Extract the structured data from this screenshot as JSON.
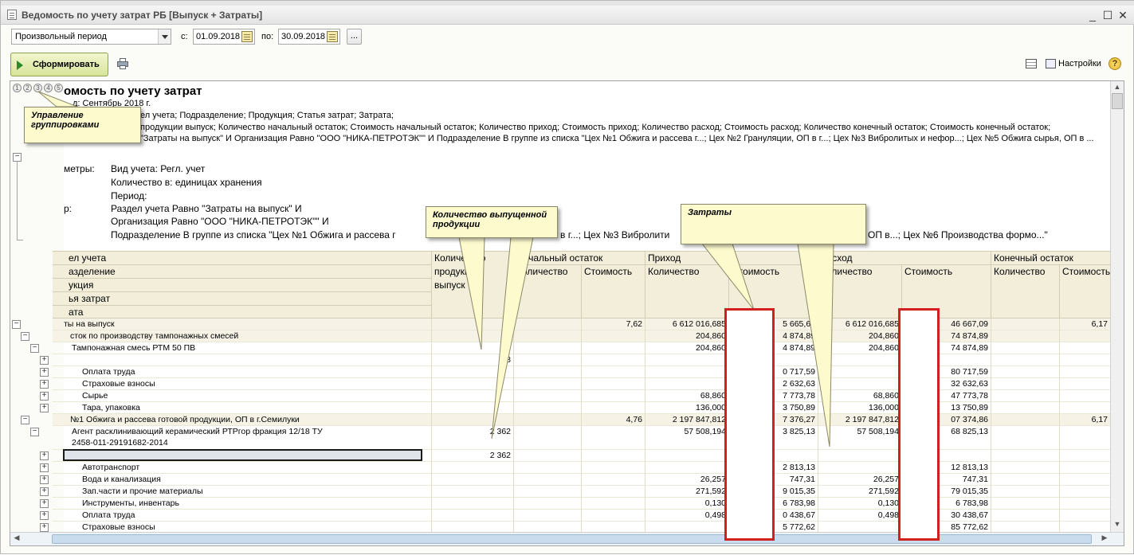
{
  "window": {
    "title": "Ведомость по учету затрат РБ [Выпуск + Затраты]",
    "controls": [
      "_",
      "☐",
      "✕"
    ]
  },
  "period": {
    "select_value": "Произвольный период",
    "from_label": "с:",
    "from_value": "01.09.2018",
    "to_label": "по:",
    "to_value": "30.09.2018",
    "more_label": "..."
  },
  "toolbar": {
    "generate_label": "Сформировать",
    "settings_label": "Настройки",
    "help_label": "?"
  },
  "group_levels": [
    "1",
    "2",
    "3",
    "4",
    "5"
  ],
  "report": {
    "title": "омость по учету затрат",
    "period_line": "д: Сентябрь 2018 г.",
    "grouping_line": "ел учета; Подразделение; Продукция; Статья затрат; Затрата;",
    "indicators_line": "продукции выпуск; Количество начальный остаток; Стоимость начальный остаток; Количество приход; Стоимость приход; Количество расход; Стоимость расход; Количество конечный остаток; Стоимость конечный остаток;",
    "filter_line": "\"Затраты на выпуск\" И Организация Равно \"ООО \"НИКА-ПЕТРОТЭК\"\" И Подразделение В группе из списка \"Цех №1 Обжига и рассева г...; Цех №2 Грануляции, ОП в г...; Цех №3 Вибролитых и нефор...; Цех №5 Обжига сырья, ОП в ...",
    "params_label": "метры:",
    "params": [
      "Вид учета: Регл. учет",
      "Количество в: единицах хранения",
      "Период:"
    ],
    "selection_label": "р:",
    "selection": [
      "Раздел учета Равно \"Затраты на выпуск\" И",
      "Организация Равно \"ООО \"НИКА-ПЕТРОТЭК\"\" И",
      "Подразделение В группе из списка \"Цех №1 Обжига и рассева г",
      "в г...; Цех №3 Вибролити",
      "ОП в...; Цех №6 Производства формо...\""
    ]
  },
  "columns": {
    "dims": [
      "ел учета",
      "азделение",
      "укция",
      "ья затрат",
      "ата"
    ],
    "qty_out": "Количество продукции выпуск",
    "qty_out_lines": [
      "Количество",
      "продукции",
      "выпуск"
    ],
    "opening": "Начальный остаток",
    "income": "Приход",
    "expense": "Расход",
    "closing": "Конечный остаток",
    "qty": "Количество",
    "cost": "Стоимость"
  },
  "rows": [
    {
      "name": "ты на выпуск",
      "out": "",
      "oq": "",
      "oc": "7,62",
      "iq": "6 612 016,685",
      "ic": "5 665,64",
      "eq": "6 612 016,685",
      "ec": "46 667,09",
      "cq": "",
      "cc": "6,17",
      "kind": "group"
    },
    {
      "name": "сток по производству тампонажных смесей",
      "out": "",
      "oq": "",
      "oc": "",
      "iq": "204,860",
      "ic": "4 874,89",
      "eq": "204,860",
      "ec": "74 874,89",
      "cq": "",
      "cc": "",
      "kind": "group"
    },
    {
      "name": "Тампонажная смесь РТМ 50 ПВ",
      "out": "68",
      "oq": "",
      "oc": "",
      "iq": "204,860",
      "ic": "4 874,89",
      "eq": "204,860",
      "ec": "74 874,89",
      "cq": "",
      "cc": "",
      "kind": "item"
    },
    {
      "name": "",
      "out": "68",
      "oq": "",
      "oc": "",
      "iq": "",
      "ic": "",
      "eq": "",
      "ec": "",
      "cq": "",
      "cc": "",
      "kind": "item"
    },
    {
      "name": "Оплата труда",
      "out": "",
      "oq": "",
      "oc": "",
      "iq": "",
      "ic": "0 717,59",
      "eq": "",
      "ec": "80 717,59",
      "cq": "",
      "cc": "",
      "kind": "item"
    },
    {
      "name": "Страховые взносы",
      "out": "",
      "oq": "",
      "oc": "",
      "iq": "",
      "ic": "2 632,63",
      "eq": "",
      "ec": "32 632,63",
      "cq": "",
      "cc": "",
      "kind": "item"
    },
    {
      "name": "Сырье",
      "out": "",
      "oq": "",
      "oc": "",
      "iq": "68,860",
      "ic": "7 773,78",
      "eq": "68,860",
      "ec": "47 773,78",
      "cq": "",
      "cc": "",
      "kind": "item"
    },
    {
      "name": "Тара, упаковка",
      "out": "",
      "oq": "",
      "oc": "",
      "iq": "136,000",
      "ic": "3 750,89",
      "eq": "136,000",
      "ec": "13 750,89",
      "cq": "",
      "cc": "",
      "kind": "item"
    },
    {
      "name": "№1 Обжига и рассева готовой продукции, ОП в г.Семилуки",
      "out": "",
      "oq": "",
      "oc": "4,76",
      "iq": "2 197 847,812",
      "ic": "7 376,27",
      "eq": "2 197 847,812",
      "ec": "07 374,86",
      "cq": "",
      "cc": "6,17",
      "kind": "group"
    },
    {
      "name": "Агент расклинивающий керамический РТРгор фракция 12/18 ТУ",
      "name2": "2458-011-29191682-2014",
      "out": "2 362",
      "oq": "",
      "oc": "",
      "iq": "57 508,194",
      "ic": "3 825,13",
      "eq": "57 508,194",
      "ec": "68 825,13",
      "cq": "",
      "cc": "",
      "kind": "item2"
    },
    {
      "name": "",
      "out": "2 362",
      "oq": "",
      "oc": "",
      "iq": "",
      "ic": "",
      "eq": "",
      "ec": "",
      "cq": "",
      "cc": "",
      "kind": "item"
    },
    {
      "name": "Автотранспорт",
      "out": "",
      "oq": "",
      "oc": "",
      "iq": "",
      "ic": "2 813,13",
      "eq": "",
      "ec": "12 813,13",
      "cq": "",
      "cc": "",
      "kind": "item"
    },
    {
      "name": "Вода и канализация",
      "out": "",
      "oq": "",
      "oc": "",
      "iq": "26,257",
      "ic": "747,31",
      "eq": "26,257",
      "ec": "747,31",
      "cq": "",
      "cc": "",
      "kind": "item"
    },
    {
      "name": "Зап.части и прочие материалы",
      "out": "",
      "oq": "",
      "oc": "",
      "iq": "271,592",
      "ic": "9 015,35",
      "eq": "271,592",
      "ec": "79 015,35",
      "cq": "",
      "cc": "",
      "kind": "item"
    },
    {
      "name": "Инструменты, инвентарь",
      "out": "",
      "oq": "",
      "oc": "",
      "iq": "0,130",
      "ic": "6 783,98",
      "eq": "0,130",
      "ec": "6 783,98",
      "cq": "",
      "cc": "",
      "kind": "item"
    },
    {
      "name": "Оплата труда",
      "out": "",
      "oq": "",
      "oc": "",
      "iq": "0,498",
      "ic": "0 438,67",
      "eq": "0,498",
      "ec": "30 438,67",
      "cq": "",
      "cc": "",
      "kind": "item"
    },
    {
      "name": "Страховые взносы",
      "out": "",
      "oq": "",
      "oc": "",
      "iq": "",
      "ic": "5 772,62",
      "eq": "",
      "ec": "85 772,62",
      "cq": "",
      "cc": "",
      "kind": "item"
    }
  ],
  "callouts": {
    "grouping": "Управление группировками",
    "quantity": "Количество выпущенной продукции",
    "costs": "Затраты"
  }
}
